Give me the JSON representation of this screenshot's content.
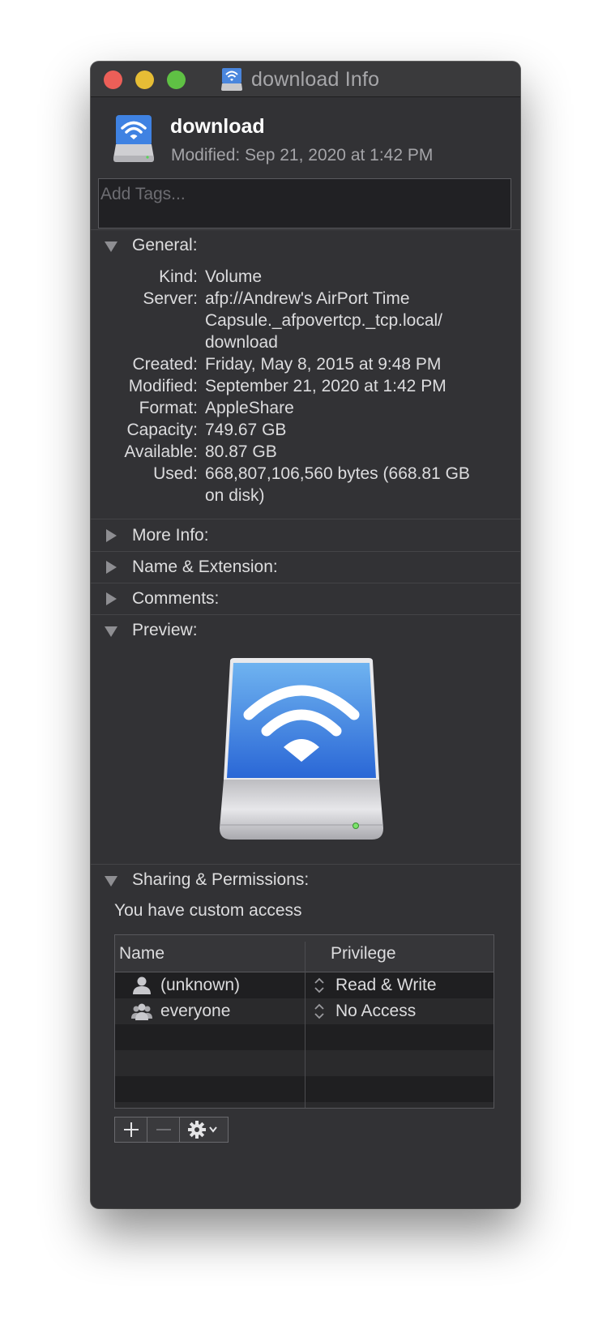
{
  "window": {
    "title": "download Info"
  },
  "header": {
    "name": "download",
    "modified": "Modified: Sep 21, 2020 at 1:42 PM",
    "tags_placeholder": "Add Tags..."
  },
  "general": {
    "title": "General:",
    "rows": [
      {
        "label": "Kind:",
        "value": "Volume"
      },
      {
        "label": "Server:",
        "value": "afp://Andrew's AirPort Time Capsule._afpovertcp._tcp.local/ download"
      },
      {
        "label": "Created:",
        "value": "Friday, May 8, 2015 at 9:48 PM"
      },
      {
        "label": "Modified:",
        "value": "September 21, 2020 at 1:42 PM"
      },
      {
        "label": "Format:",
        "value": "AppleShare"
      },
      {
        "label": "Capacity:",
        "value": "749.67 GB"
      },
      {
        "label": "Available:",
        "value": "80.87 GB"
      },
      {
        "label": "Used:",
        "value": "668,807,106,560 bytes (668.81 GB on disk)"
      }
    ]
  },
  "sections": {
    "more_info": "More Info:",
    "name_extension": "Name & Extension:",
    "comments": "Comments:",
    "preview": "Preview:",
    "sharing": "Sharing & Permissions:"
  },
  "sharing": {
    "access_text": "You have custom access",
    "columns": {
      "name": "Name",
      "privilege": "Privilege"
    },
    "rows": [
      {
        "name": "(unknown)",
        "privilege": "Read & Write",
        "icon": "user-icon"
      },
      {
        "name": "everyone",
        "privilege": "No Access",
        "icon": "group-icon"
      }
    ]
  },
  "colors": {
    "window_bg": "#323235",
    "close": "#ec5f58",
    "minimize": "#e6bd35",
    "maximize": "#5fc144",
    "drive_blue": "#3d7fe0"
  }
}
